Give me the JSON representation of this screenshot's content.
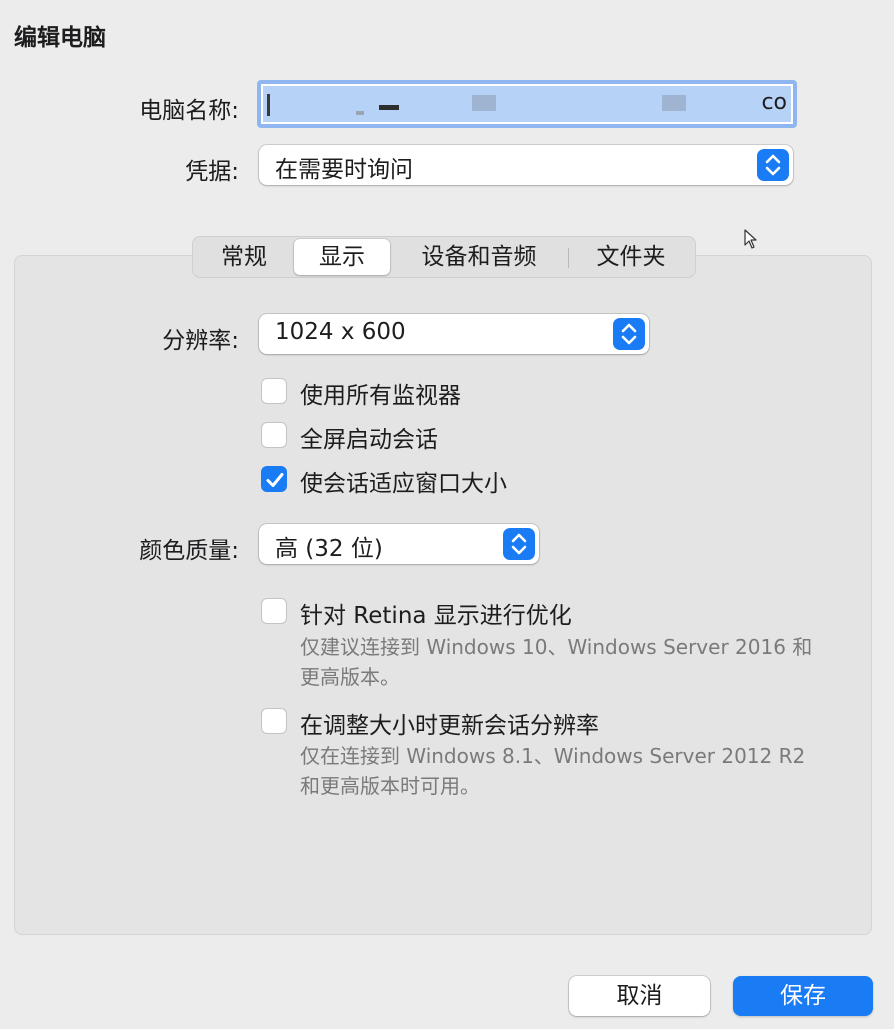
{
  "dialog": {
    "title": "编辑电脑"
  },
  "form": {
    "pc_name_label": "电脑名称:",
    "pc_name_value_suffix": "co",
    "credentials_label": "凭据:",
    "credentials_value": "在需要时询问"
  },
  "tabs": [
    {
      "label": "常规",
      "active": false
    },
    {
      "label": "显示",
      "active": true
    },
    {
      "label": "设备和音频",
      "active": false
    },
    {
      "label": "文件夹",
      "active": false
    }
  ],
  "display": {
    "resolution_label": "分辨率:",
    "resolution_value": "1024 x 600",
    "options": [
      {
        "label": "使用所有监视器",
        "checked": false
      },
      {
        "label": "全屏启动会话",
        "checked": false
      },
      {
        "label": "使会话适应窗口大小",
        "checked": true
      }
    ],
    "color_label": "颜色质量:",
    "color_value": "高 (32 位)",
    "retina": {
      "label": "针对 Retina 显示进行优化",
      "checked": false,
      "hint": "仅建议连接到 Windows 10、Windows Server 2016 和更高版本。"
    },
    "dynamic_resolution": {
      "label": "在调整大小时更新会话分辨率",
      "checked": false,
      "hint": "仅在连接到 Windows 8.1、Windows Server 2012 R2 和更高版本时可用。"
    }
  },
  "buttons": {
    "cancel": "取消",
    "save": "保存"
  },
  "colors": {
    "accent": "#1a7cf5",
    "background": "#ececec",
    "panel": "#e4e4e4",
    "selection": "#b6d2f7"
  }
}
